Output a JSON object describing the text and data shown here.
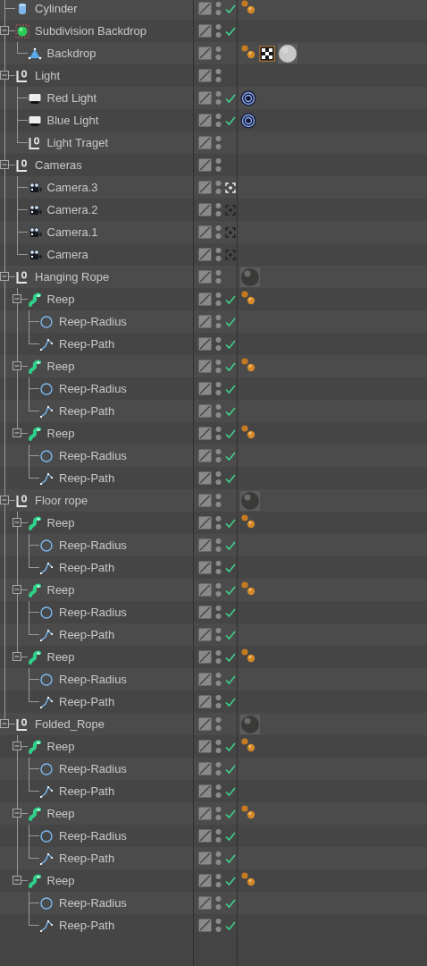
{
  "items": [
    {
      "name": "Cylinder",
      "kind": "cylinder",
      "enabled": true,
      "tags": [
        {
          "kind": "phong"
        }
      ]
    },
    {
      "name": "Subdivision Backdrop",
      "kind": "subdivision",
      "expanded": true,
      "enabled": true,
      "children": [
        {
          "name": "Backdrop",
          "kind": "polygon",
          "enabled": false,
          "tags": [
            {
              "kind": "phong"
            },
            {
              "kind": "texture"
            },
            {
              "kind": "material",
              "color": "#c8c8c8"
            }
          ]
        }
      ]
    },
    {
      "name": "Light",
      "kind": "null",
      "expanded": true,
      "enabled": false,
      "children": [
        {
          "name": "Red Light",
          "kind": "light",
          "enabled": true,
          "tags": [
            {
              "kind": "target"
            }
          ]
        },
        {
          "name": "Blue Light",
          "kind": "light",
          "enabled": true,
          "tags": [
            {
              "kind": "target"
            }
          ]
        },
        {
          "name": "Light Traget",
          "kind": "null",
          "enabled": false
        }
      ]
    },
    {
      "name": "Cameras",
      "kind": "null",
      "expanded": true,
      "enabled": false,
      "children": [
        {
          "name": "Camera.3",
          "kind": "camera",
          "enabled": false,
          "camera_view": {
            "selected": true
          }
        },
        {
          "name": "Camera.2",
          "kind": "camera",
          "enabled": false,
          "camera_view": {
            "selected": false
          }
        },
        {
          "name": "Camera.1",
          "kind": "camera",
          "enabled": false,
          "camera_view": {
            "selected": false
          }
        },
        {
          "name": "Camera",
          "kind": "camera",
          "enabled": false,
          "camera_view": {
            "selected": false
          }
        }
      ]
    },
    {
      "name": "Hanging Rope",
      "kind": "null",
      "expanded": true,
      "enabled": false,
      "tags": [
        {
          "kind": "material",
          "color": "#3a3a38"
        }
      ],
      "children": [
        {
          "name": "Reep",
          "kind": "sweep",
          "expanded": true,
          "enabled": true,
          "tags": [
            {
              "kind": "phong"
            }
          ],
          "children": [
            {
              "name": "Reep-Radius",
              "kind": "circle",
              "enabled": true
            },
            {
              "name": "Reep-Path",
              "kind": "spline",
              "enabled": true
            }
          ]
        },
        {
          "name": "Reep",
          "kind": "sweep",
          "expanded": true,
          "enabled": true,
          "tags": [
            {
              "kind": "phong"
            }
          ],
          "children": [
            {
              "name": "Reep-Radius",
              "kind": "circle",
              "enabled": true
            },
            {
              "name": "Reep-Path",
              "kind": "spline",
              "enabled": true
            }
          ]
        },
        {
          "name": "Reep",
          "kind": "sweep",
          "expanded": true,
          "enabled": true,
          "tags": [
            {
              "kind": "phong"
            }
          ],
          "children": [
            {
              "name": "Reep-Radius",
              "kind": "circle",
              "enabled": true
            },
            {
              "name": "Reep-Path",
              "kind": "spline",
              "enabled": true
            }
          ]
        }
      ]
    },
    {
      "name": "Floor rope",
      "kind": "null",
      "expanded": true,
      "enabled": false,
      "tags": [
        {
          "kind": "material",
          "color": "#3a3a38"
        }
      ],
      "children": [
        {
          "name": "Reep",
          "kind": "sweep",
          "expanded": true,
          "enabled": true,
          "tags": [
            {
              "kind": "phong"
            }
          ],
          "children": [
            {
              "name": "Reep-Radius",
              "kind": "circle",
              "enabled": true
            },
            {
              "name": "Reep-Path",
              "kind": "spline",
              "enabled": true
            }
          ]
        },
        {
          "name": "Reep",
          "kind": "sweep",
          "expanded": true,
          "enabled": true,
          "tags": [
            {
              "kind": "phong"
            }
          ],
          "children": [
            {
              "name": "Reep-Radius",
              "kind": "circle",
              "enabled": true
            },
            {
              "name": "Reep-Path",
              "kind": "spline",
              "enabled": true
            }
          ]
        },
        {
          "name": "Reep",
          "kind": "sweep",
          "expanded": true,
          "enabled": true,
          "tags": [
            {
              "kind": "phong"
            }
          ],
          "children": [
            {
              "name": "Reep-Radius",
              "kind": "circle",
              "enabled": true
            },
            {
              "name": "Reep-Path",
              "kind": "spline",
              "enabled": true
            }
          ]
        }
      ]
    },
    {
      "name": "Folded_Rope",
      "kind": "null",
      "expanded": true,
      "enabled": false,
      "tags": [
        {
          "kind": "material",
          "color": "#3a3a38"
        }
      ],
      "children": [
        {
          "name": "Reep",
          "kind": "sweep",
          "expanded": true,
          "enabled": true,
          "tags": [
            {
              "kind": "phong"
            }
          ],
          "children": [
            {
              "name": "Reep-Radius",
              "kind": "circle",
              "enabled": true
            },
            {
              "name": "Reep-Path",
              "kind": "spline",
              "enabled": true
            }
          ]
        },
        {
          "name": "Reep",
          "kind": "sweep",
          "expanded": true,
          "enabled": true,
          "tags": [
            {
              "kind": "phong"
            }
          ],
          "children": [
            {
              "name": "Reep-Radius",
              "kind": "circle",
              "enabled": true
            },
            {
              "name": "Reep-Path",
              "kind": "spline",
              "enabled": true
            }
          ]
        },
        {
          "name": "Reep",
          "kind": "sweep",
          "expanded": true,
          "enabled": true,
          "tags": [
            {
              "kind": "phong"
            }
          ],
          "children": [
            {
              "name": "Reep-Radius",
              "kind": "circle",
              "enabled": true
            },
            {
              "name": "Reep-Path",
              "kind": "spline",
              "enabled": true
            }
          ]
        }
      ]
    }
  ]
}
